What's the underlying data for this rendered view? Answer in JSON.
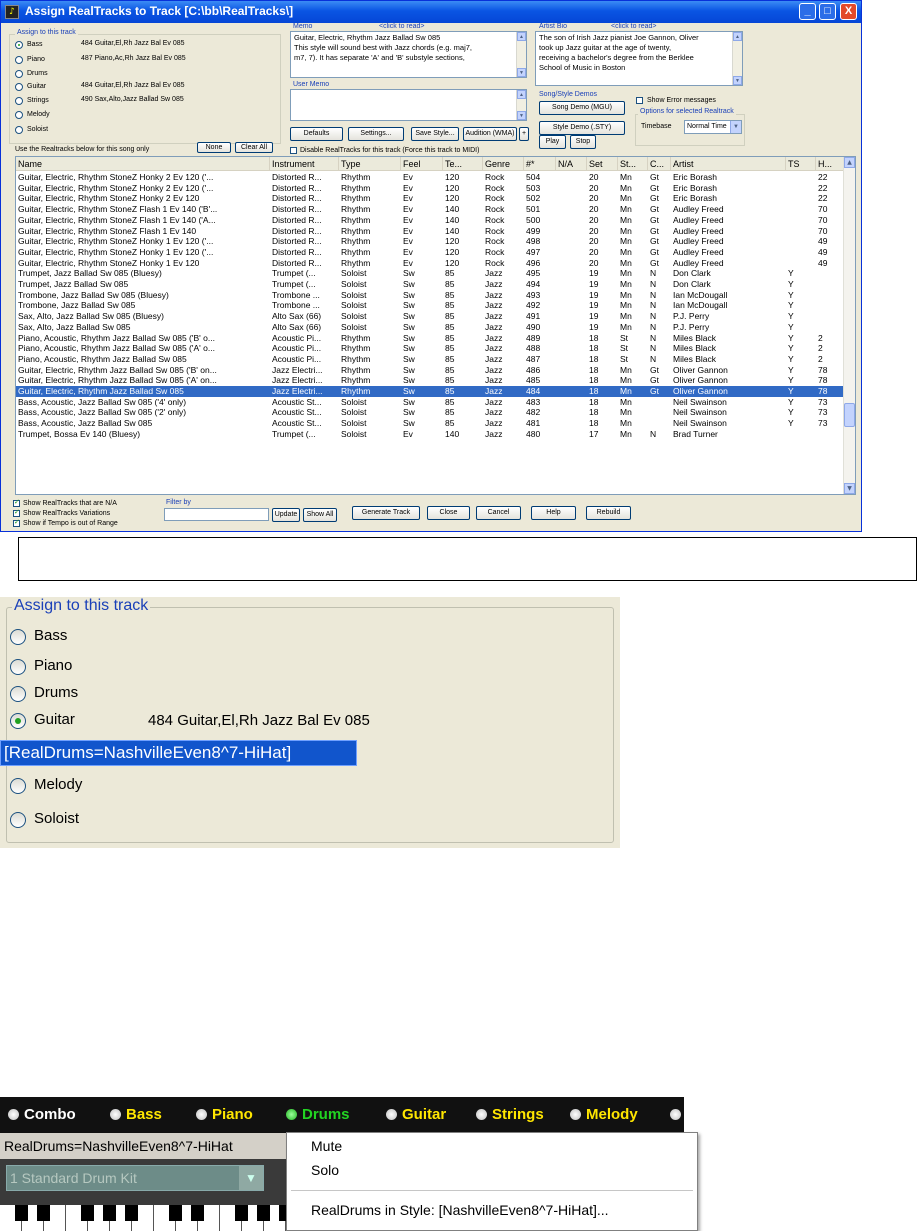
{
  "window": {
    "title": "Assign RealTracks to Track  [C:\\bb\\RealTracks\\]",
    "controls": {
      "minimize": "_",
      "maximize": "□",
      "close": "X"
    }
  },
  "assign_group": {
    "label": "Assign to this track",
    "tracks": [
      {
        "name": "Bass",
        "value": "484 Guitar,El,Rh Jazz Bal Ev 085",
        "selected": true
      },
      {
        "name": "Piano",
        "value": "487 Piano,Ac,Rh Jazz Bal Ev 085",
        "selected": false
      },
      {
        "name": "Drums",
        "value": "",
        "selected": false
      },
      {
        "name": "Guitar",
        "value": "484 Guitar,El,Rh Jazz Bal Ev 085",
        "selected": false
      },
      {
        "name": "Strings",
        "value": "490 Sax,Alto,Jazz Ballad Sw 085",
        "selected": false
      },
      {
        "name": "Melody",
        "value": "",
        "selected": false
      },
      {
        "name": "Soloist",
        "value": "",
        "selected": false
      }
    ],
    "use_hint": "Use the Realtracks below for this song only",
    "none_button": "None",
    "clear_all_button": "Clear All"
  },
  "memo": {
    "label": "Memo",
    "click_hint": "<click to read>",
    "lines": [
      "Guitar, Electric, Rhythm Jazz Ballad Sw 085",
      "This style will sound best with Jazz chords (e.g. maj7,",
      "m7, 7).  It has separate 'A' and 'B' substyle sections,"
    ]
  },
  "artist_bio": {
    "label": "Artist Bio",
    "click_hint": "<click to read>",
    "lines": [
      "The son of Irish Jazz pianist Joe Gannon, Oliver",
      "took up Jazz guitar at the age of twenty,",
      "receiving a bachelor's degree from the Berklee",
      "School of Music in Boston"
    ]
  },
  "user_memo": {
    "label": "User Memo"
  },
  "buttons": {
    "defaults": "Defaults",
    "settings": "Settings...",
    "save_style": "Save Style...",
    "audition": "Audition (WMA)",
    "plus": "+",
    "song_demo": "Song Demo (MGU)",
    "style_demo": "Style Demo (.STY)",
    "play": "Play",
    "stop": "Stop",
    "update": "Update",
    "show_all": "Show All",
    "generate": "Generate Track",
    "close": "Close",
    "cancel": "Cancel",
    "help": "Help",
    "rebuild": "Rebuild"
  },
  "demos_label": "Song/Style Demos",
  "show_error": "Show Error messages",
  "options_label": "Options for selected Realtrack",
  "timebase_label": "Timebase",
  "timebase_value": "Normal Time",
  "disable_label": "Disable RealTracks for this track (Force this track to MIDI)",
  "filter_label": "Filter by",
  "checkboxes": [
    "Show RealTracks that are N/A",
    "Show RealTracks Variations",
    "Show if Tempo is out of Range"
  ],
  "table": {
    "columns": [
      "Name",
      "Instrument",
      "Type",
      "Feel",
      "Te...",
      "Genre",
      "#*",
      "N/A",
      "Set",
      "St...",
      "C...",
      "Artist",
      "TS",
      "H..."
    ],
    "rows": [
      [
        "Guitar, Electric, Rhythm StoneZ Honky 2 Ev 120 ('...",
        "Distorted R...",
        "Rhythm",
        "Ev",
        "120",
        "Rock",
        "504",
        "",
        "20",
        "Mn",
        "Gt",
        "Eric Borash",
        "",
        "22"
      ],
      [
        "Guitar, Electric, Rhythm StoneZ Honky 2 Ev 120 ('...",
        "Distorted R...",
        "Rhythm",
        "Ev",
        "120",
        "Rock",
        "503",
        "",
        "20",
        "Mn",
        "Gt",
        "Eric Borash",
        "",
        "22"
      ],
      [
        "Guitar, Electric, Rhythm StoneZ Honky 2 Ev 120",
        "Distorted R...",
        "Rhythm",
        "Ev",
        "120",
        "Rock",
        "502",
        "",
        "20",
        "Mn",
        "Gt",
        "Eric Borash",
        "",
        "22"
      ],
      [
        "Guitar, Electric, Rhythm StoneZ Flash 1 Ev 140 ('B'...",
        "Distorted R...",
        "Rhythm",
        "Ev",
        "140",
        "Rock",
        "501",
        "",
        "20",
        "Mn",
        "Gt",
        "Audley Freed",
        "",
        "70"
      ],
      [
        "Guitar, Electric, Rhythm StoneZ Flash 1 Ev 140 ('A...",
        "Distorted R...",
        "Rhythm",
        "Ev",
        "140",
        "Rock",
        "500",
        "",
        "20",
        "Mn",
        "Gt",
        "Audley Freed",
        "",
        "70"
      ],
      [
        "Guitar, Electric, Rhythm StoneZ Flash 1 Ev 140",
        "Distorted R...",
        "Rhythm",
        "Ev",
        "140",
        "Rock",
        "499",
        "",
        "20",
        "Mn",
        "Gt",
        "Audley Freed",
        "",
        "70"
      ],
      [
        "Guitar, Electric, Rhythm StoneZ Honky 1 Ev 120 ('...",
        "Distorted R...",
        "Rhythm",
        "Ev",
        "120",
        "Rock",
        "498",
        "",
        "20",
        "Mn",
        "Gt",
        "Audley Freed",
        "",
        "49"
      ],
      [
        "Guitar, Electric, Rhythm StoneZ Honky 1 Ev 120 ('...",
        "Distorted R...",
        "Rhythm",
        "Ev",
        "120",
        "Rock",
        "497",
        "",
        "20",
        "Mn",
        "Gt",
        "Audley Freed",
        "",
        "49"
      ],
      [
        "Guitar, Electric, Rhythm StoneZ Honky 1 Ev 120",
        "Distorted R...",
        "Rhythm",
        "Ev",
        "120",
        "Rock",
        "496",
        "",
        "20",
        "Mn",
        "Gt",
        "Audley Freed",
        "",
        "49"
      ],
      [
        "Trumpet, Jazz Ballad Sw 085 (Bluesy)",
        "Trumpet (...",
        "Soloist",
        "Sw",
        "85",
        "Jazz",
        "495",
        "",
        "19",
        "Mn",
        "N",
        "Don Clark",
        "Y",
        ""
      ],
      [
        "Trumpet, Jazz Ballad Sw 085",
        "Trumpet (...",
        "Soloist",
        "Sw",
        "85",
        "Jazz",
        "494",
        "",
        "19",
        "Mn",
        "N",
        "Don Clark",
        "Y",
        ""
      ],
      [
        "Trombone, Jazz Ballad Sw 085 (Bluesy)",
        "Trombone ...",
        "Soloist",
        "Sw",
        "85",
        "Jazz",
        "493",
        "",
        "19",
        "Mn",
        "N",
        "Ian McDougall",
        "Y",
        ""
      ],
      [
        "Trombone, Jazz Ballad Sw 085",
        "Trombone ...",
        "Soloist",
        "Sw",
        "85",
        "Jazz",
        "492",
        "",
        "19",
        "Mn",
        "N",
        "Ian McDougall",
        "Y",
        ""
      ],
      [
        "Sax, Alto, Jazz Ballad Sw 085 (Bluesy)",
        "Alto Sax (66)",
        "Soloist",
        "Sw",
        "85",
        "Jazz",
        "491",
        "",
        "19",
        "Mn",
        "N",
        "P.J. Perry",
        "Y",
        ""
      ],
      [
        "Sax, Alto, Jazz Ballad Sw 085",
        "Alto Sax (66)",
        "Soloist",
        "Sw",
        "85",
        "Jazz",
        "490",
        "",
        "19",
        "Mn",
        "N",
        "P.J. Perry",
        "Y",
        ""
      ],
      [
        "Piano, Acoustic, Rhythm Jazz Ballad Sw 085 ('B' o...",
        "Acoustic Pi...",
        "Rhythm",
        "Sw",
        "85",
        "Jazz",
        "489",
        "",
        "18",
        "St",
        "N",
        "Miles Black",
        "Y",
        "2"
      ],
      [
        "Piano, Acoustic, Rhythm Jazz Ballad Sw 085 ('A' o...",
        "Acoustic Pi...",
        "Rhythm",
        "Sw",
        "85",
        "Jazz",
        "488",
        "",
        "18",
        "St",
        "N",
        "Miles Black",
        "Y",
        "2"
      ],
      [
        "Piano, Acoustic, Rhythm Jazz Ballad Sw 085",
        "Acoustic Pi...",
        "Rhythm",
        "Sw",
        "85",
        "Jazz",
        "487",
        "",
        "18",
        "St",
        "N",
        "Miles Black",
        "Y",
        "2"
      ],
      [
        "Guitar, Electric, Rhythm Jazz Ballad Sw 085 ('B' on...",
        "Jazz Electri...",
        "Rhythm",
        "Sw",
        "85",
        "Jazz",
        "486",
        "",
        "18",
        "Mn",
        "Gt",
        "Oliver Gannon",
        "Y",
        "78"
      ],
      [
        "Guitar, Electric, Rhythm Jazz Ballad Sw 085 ('A' on...",
        "Jazz Electri...",
        "Rhythm",
        "Sw",
        "85",
        "Jazz",
        "485",
        "",
        "18",
        "Mn",
        "Gt",
        "Oliver Gannon",
        "Y",
        "78"
      ],
      [
        "Guitar, Electric, Rhythm Jazz Ballad Sw 085",
        "Jazz Electri...",
        "Rhythm",
        "Sw",
        "85",
        "Jazz",
        "484",
        "",
        "18",
        "Mn",
        "Gt",
        "Oliver Gannon",
        "Y",
        "78"
      ],
      [
        "Bass, Acoustic, Jazz Ballad Sw 085 ('4' only)",
        "Acoustic St...",
        "Soloist",
        "Sw",
        "85",
        "Jazz",
        "483",
        "",
        "18",
        "Mn",
        "",
        "Neil Swainson",
        "Y",
        "73"
      ],
      [
        "Bass, Acoustic, Jazz Ballad Sw 085 ('2' only)",
        "Acoustic St...",
        "Soloist",
        "Sw",
        "85",
        "Jazz",
        "482",
        "",
        "18",
        "Mn",
        "",
        "Neil Swainson",
        "Y",
        "73"
      ],
      [
        "Bass, Acoustic, Jazz Ballad Sw 085",
        "Acoustic St...",
        "Soloist",
        "Sw",
        "85",
        "Jazz",
        "481",
        "",
        "18",
        "Mn",
        "",
        "Neil Swainson",
        "Y",
        "73"
      ],
      [
        "Trumpet, Bossa Ev 140 (Bluesy)",
        "Trumpet (...",
        "Soloist",
        "Ev",
        "140",
        "Jazz",
        "480",
        "",
        "17",
        "Mn",
        "N",
        "Brad Turner",
        "",
        ""
      ]
    ],
    "selected_index": 20
  },
  "zoom_panel": {
    "label": "Assign to this track",
    "tracks": [
      {
        "name": "Bass",
        "value": "",
        "selected": false
      },
      {
        "name": "Piano",
        "value": "",
        "selected": false
      },
      {
        "name": "Drums",
        "value": "",
        "selected": false
      },
      {
        "name": "Guitar",
        "value": "484 Guitar,El,Rh Jazz Bal Ev 085",
        "selected": true
      },
      {
        "name": "Strings",
        "value": "",
        "selected": false
      },
      {
        "name": "Melody",
        "value": "",
        "selected": false
      },
      {
        "name": "Soloist",
        "value": "",
        "selected": false
      }
    ]
  },
  "realdrums_label": "[RealDrums=NashvilleEven8^7-HiHat]",
  "mixer": {
    "tracks": [
      {
        "name": "Combo",
        "color": "#ffffff",
        "on": false
      },
      {
        "name": "Bass",
        "color": "#ffe600",
        "on": false
      },
      {
        "name": "Piano",
        "color": "#ffe600",
        "on": false
      },
      {
        "name": "Drums",
        "color": "#22d422",
        "on": true
      },
      {
        "name": "Guitar",
        "color": "#ffe600",
        "on": false
      },
      {
        "name": "Strings",
        "color": "#ffe600",
        "on": false
      },
      {
        "name": "Melody",
        "color": "#ffe600",
        "on": false
      }
    ],
    "realdrums_text": "RealDrums=NashvilleEven8^7-HiHat",
    "kit": "1 Standard Drum Kit"
  },
  "context_menu": {
    "items": [
      "Mute",
      "Solo",
      "RealDrums in Style: [NashvilleEven8^7-HiHat]..."
    ]
  }
}
